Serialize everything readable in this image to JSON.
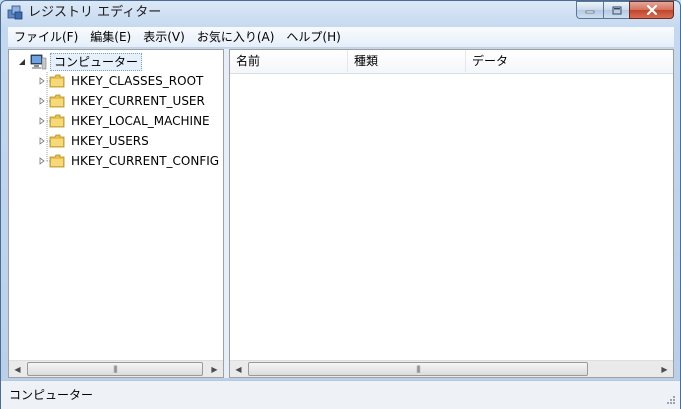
{
  "window": {
    "title": "レジストリ エディター",
    "icon": "registry-editor-icon",
    "caption_buttons": [
      "minimize-icon",
      "maximize-icon",
      "close-icon"
    ]
  },
  "menubar": {
    "items": [
      "ファイル(F)",
      "編集(E)",
      "表示(V)",
      "お気に入り(A)",
      "ヘルプ(H)"
    ]
  },
  "tree": {
    "root": {
      "label": "コンピューター",
      "icon": "computer-icon",
      "expanded": true
    },
    "children": [
      {
        "label": "HKEY_CLASSES_ROOT",
        "icon": "folder-icon"
      },
      {
        "label": "HKEY_CURRENT_USER",
        "icon": "folder-icon"
      },
      {
        "label": "HKEY_LOCAL_MACHINE",
        "icon": "folder-icon"
      },
      {
        "label": "HKEY_USERS",
        "icon": "folder-icon"
      },
      {
        "label": "HKEY_CURRENT_CONFIG",
        "icon": "folder-icon"
      }
    ]
  },
  "list": {
    "columns": [
      "名前",
      "種類",
      "データ"
    ]
  },
  "statusbar": {
    "text": "コンピューター"
  },
  "colors": {
    "frame": "#c4d8ef",
    "close_button": "#c1442a",
    "folder": "#e8c04a",
    "selection_border": "#7da2ce"
  }
}
